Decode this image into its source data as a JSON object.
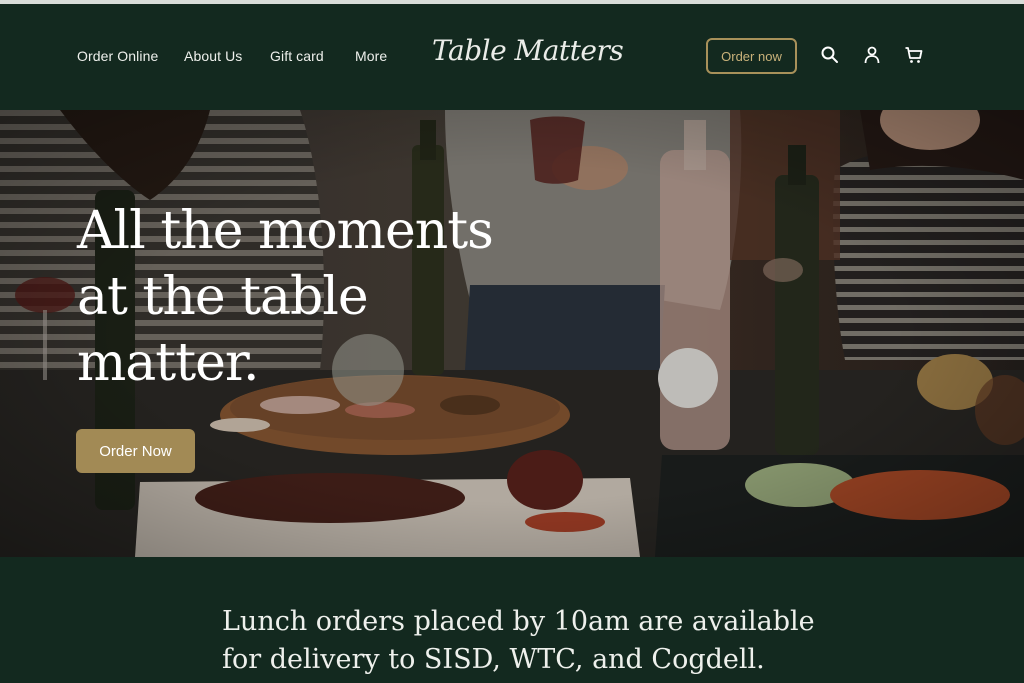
{
  "nav": {
    "items": [
      {
        "label": "Order Online"
      },
      {
        "label": "About Us"
      },
      {
        "label": "Gift card"
      },
      {
        "label": "More"
      }
    ],
    "logo_text": "Table Matters",
    "order_button": "Order now",
    "icons": [
      "search-icon",
      "account-icon",
      "cart-icon"
    ]
  },
  "hero": {
    "headline_lines": [
      "All the moments",
      "at the table",
      "matter."
    ],
    "cta_label": "Order Now"
  },
  "announcement": {
    "lines": [
      "Lunch orders placed by 10am are available",
      "for delivery to SISD, WTC, and Cogdell."
    ]
  },
  "colors": {
    "background": "#13291f",
    "accent_gold": "#a28a55",
    "text_light": "#eef0ec"
  }
}
